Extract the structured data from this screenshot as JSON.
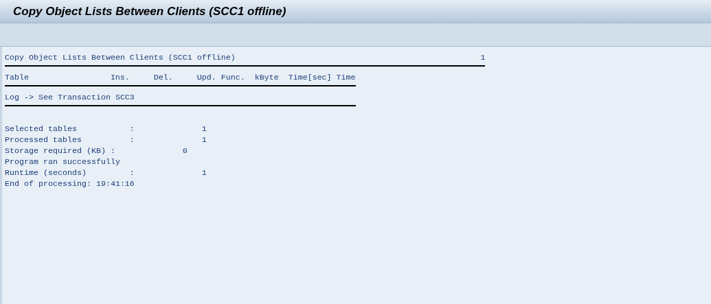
{
  "window": {
    "title": "Copy Object Lists Between Clients (SCC1 offline)"
  },
  "report": {
    "title": "Copy Object Lists Between Clients (SCC1 offline)",
    "page": "1",
    "columns": [
      "Table",
      "Ins.",
      "Del.",
      "Upd.",
      "Func.",
      "kByte",
      "Time[sec]",
      "Time"
    ],
    "log_note": "Log -> See Transaction SCC3",
    "summary": [
      {
        "kind": "count",
        "label": "Selected tables",
        "separator": ":",
        "value": "1"
      },
      {
        "kind": "count",
        "label": "Processed tables",
        "separator": ":",
        "value": "1"
      },
      {
        "kind": "size",
        "label": "Storage required (KB)",
        "separator": ":",
        "value": "0"
      },
      {
        "kind": "message",
        "label": "Program ran successfully"
      },
      {
        "kind": "count",
        "label": "Runtime (seconds)",
        "separator": ":",
        "value": "1"
      },
      {
        "kind": "message",
        "label": "End of processing: 19:41:16"
      }
    ]
  }
}
